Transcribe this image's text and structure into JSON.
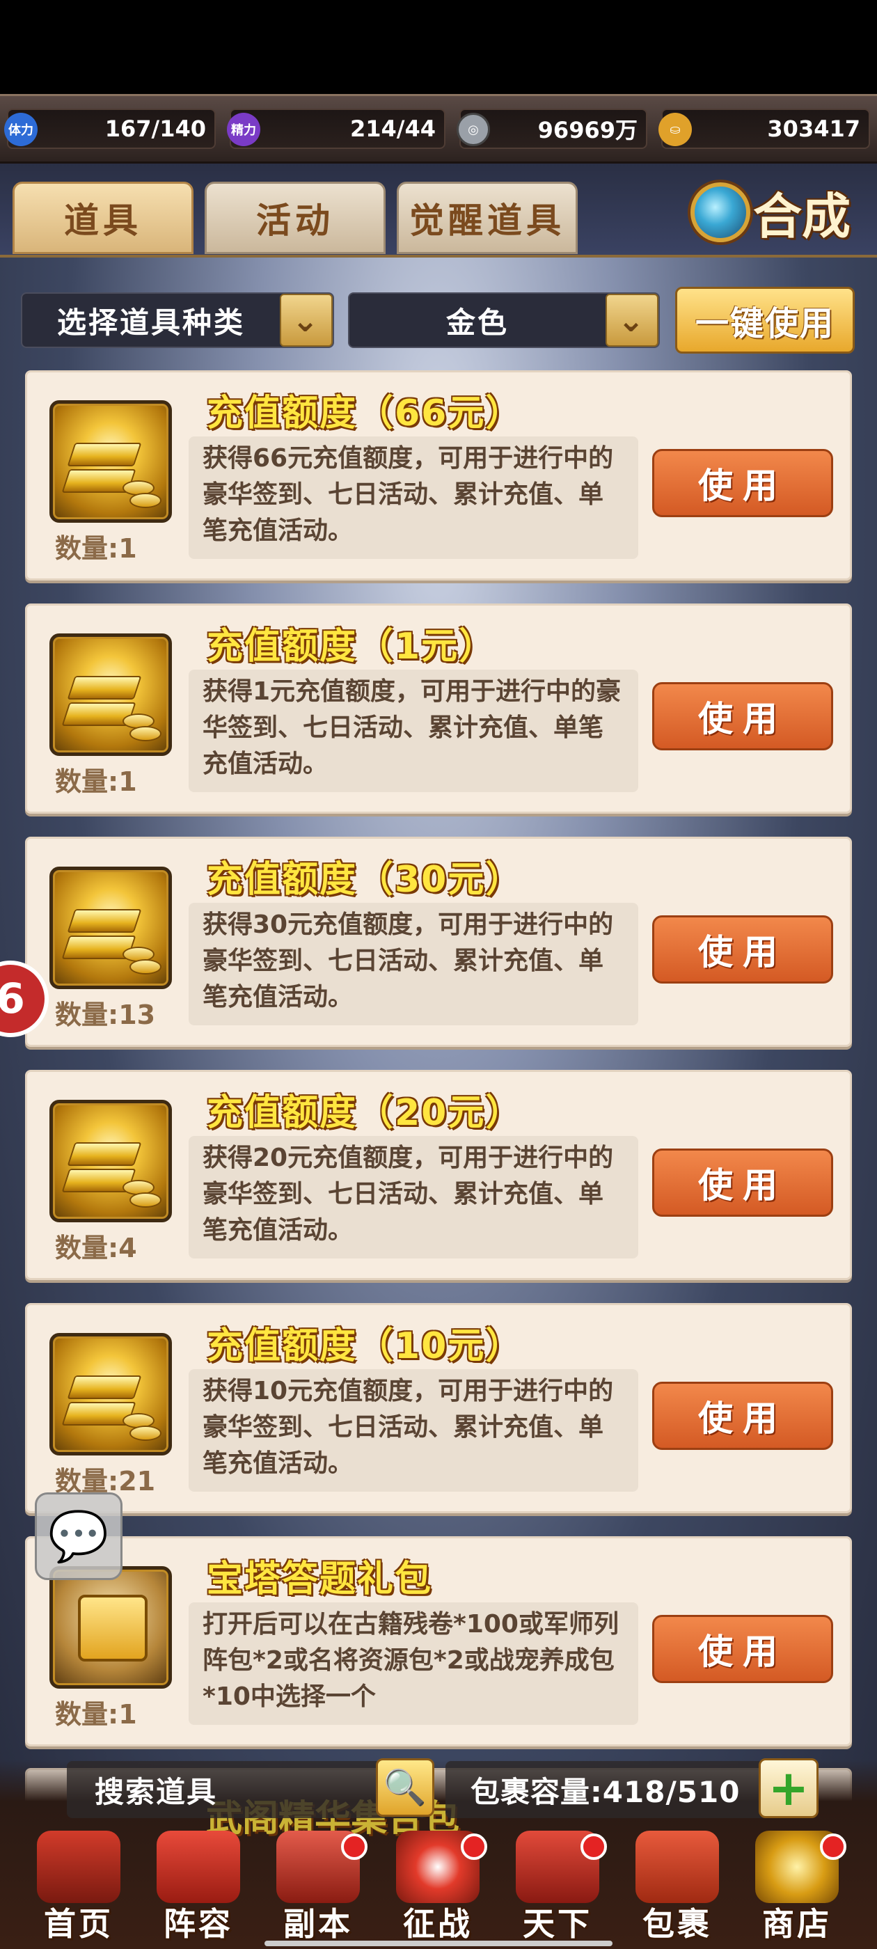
{
  "resources": [
    {
      "icon": "stamina-icon",
      "icon_text": "体力",
      "value": "167/140",
      "color": "#2d6bd6"
    },
    {
      "icon": "energy-icon",
      "icon_text": "精力",
      "value": "214/44",
      "color": "#7a3bc6"
    },
    {
      "icon": "silver-coin-icon",
      "icon_text": "",
      "value": "96969万",
      "color": "#9aa0a8"
    },
    {
      "icon": "gold-ingot-icon",
      "icon_text": "",
      "value": "303417",
      "color": "#e0a12a"
    }
  ],
  "tabs": [
    {
      "label": "道具",
      "active": true
    },
    {
      "label": "活动",
      "active": false
    },
    {
      "label": "觉醒道具",
      "active": false
    }
  ],
  "synthesize_label": "合成",
  "filters": {
    "type_select": "选择道具种类",
    "quality_select": "金色",
    "use_all_label": "一键使用"
  },
  "items": [
    {
      "title": "充值额度（66元）",
      "quantity": "数量:1",
      "description": "获得66元充值额度，可用于进行中的豪华签到、七日活动、累计充值、单笔充值活动。",
      "button": "使用",
      "icon": "gold-bars-icon"
    },
    {
      "title": "充值额度（1元）",
      "quantity": "数量:1",
      "description": "获得1元充值额度，可用于进行中的豪华签到、七日活动、累计充值、单笔充值活动。",
      "button": "使用",
      "icon": "gold-bars-icon"
    },
    {
      "title": "充值额度（30元）",
      "quantity": "数量:13",
      "description": "获得30元充值额度，可用于进行中的豪华签到、七日活动、累计充值、单笔充值活动。",
      "button": "使用",
      "icon": "gold-bars-icon"
    },
    {
      "title": "充值额度（20元）",
      "quantity": "数量:4",
      "description": "获得20元充值额度，可用于进行中的豪华签到、七日活动、累计充值、单笔充值活动。",
      "button": "使用",
      "icon": "gold-bars-icon"
    },
    {
      "title": "充值额度（10元）",
      "quantity": "数量:21",
      "description": "获得10元充值额度，可用于进行中的豪华签到、七日活动、累计充值、单笔充值活动。",
      "button": "使用",
      "icon": "gold-bars-icon"
    },
    {
      "title": "宝塔答题礼包",
      "quantity": "数量:1",
      "description": "打开后可以在古籍残卷*100或军师列阵包*2或名将资源包*2或战宠养成包*10中选择一个",
      "button": "使用",
      "icon": "gift-box-icon"
    }
  ],
  "next_item_title": "武阁精华集合包",
  "search": {
    "placeholder": "搜索道具"
  },
  "capacity": "包裹容量:418/510",
  "nav": [
    {
      "label": "首页",
      "icon": "home-pagoda-icon",
      "badge": false
    },
    {
      "label": "阵容",
      "icon": "lineup-flag-icon",
      "badge": false
    },
    {
      "label": "副本",
      "icon": "dungeon-sword-icon",
      "badge": true
    },
    {
      "label": "征战",
      "icon": "battle-target-icon",
      "badge": true
    },
    {
      "label": "天下",
      "icon": "world-scroll-icon",
      "badge": true
    },
    {
      "label": "包裹",
      "icon": "bag-icon",
      "badge": false
    },
    {
      "label": "商店",
      "icon": "shop-coins-icon",
      "badge": true
    }
  ]
}
